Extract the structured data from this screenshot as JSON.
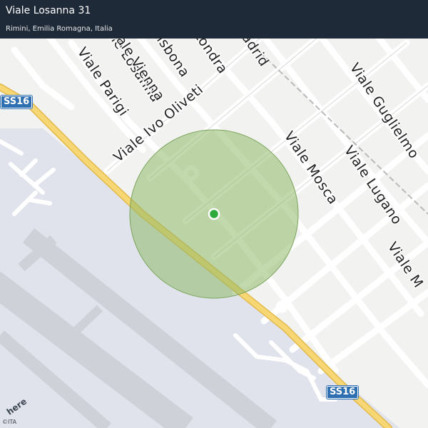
{
  "header": {
    "title": "Viale Losanna 31",
    "subtitle": "Rimini, Emilia Romagna, Italia"
  },
  "map": {
    "highways": [
      {
        "label": "SS16",
        "key": "a"
      },
      {
        "label": "SS16",
        "key": "b"
      }
    ],
    "streets": [
      "Viale Losanna",
      "Viale Lisbona",
      "Viale Londra",
      "Viale Madrid",
      "Viale Vienna",
      "Viale Parigi",
      "Viale Ivo Oliveti",
      "Viale Mosca",
      "Viale Lugano",
      "Viale Guglielmo",
      "Viale M"
    ],
    "location_accuracy": {
      "center_color": "#2eaa3c",
      "area_color": "#8fb96a"
    }
  },
  "attribution": {
    "brand": "here",
    "copyright": "©ITA"
  }
}
